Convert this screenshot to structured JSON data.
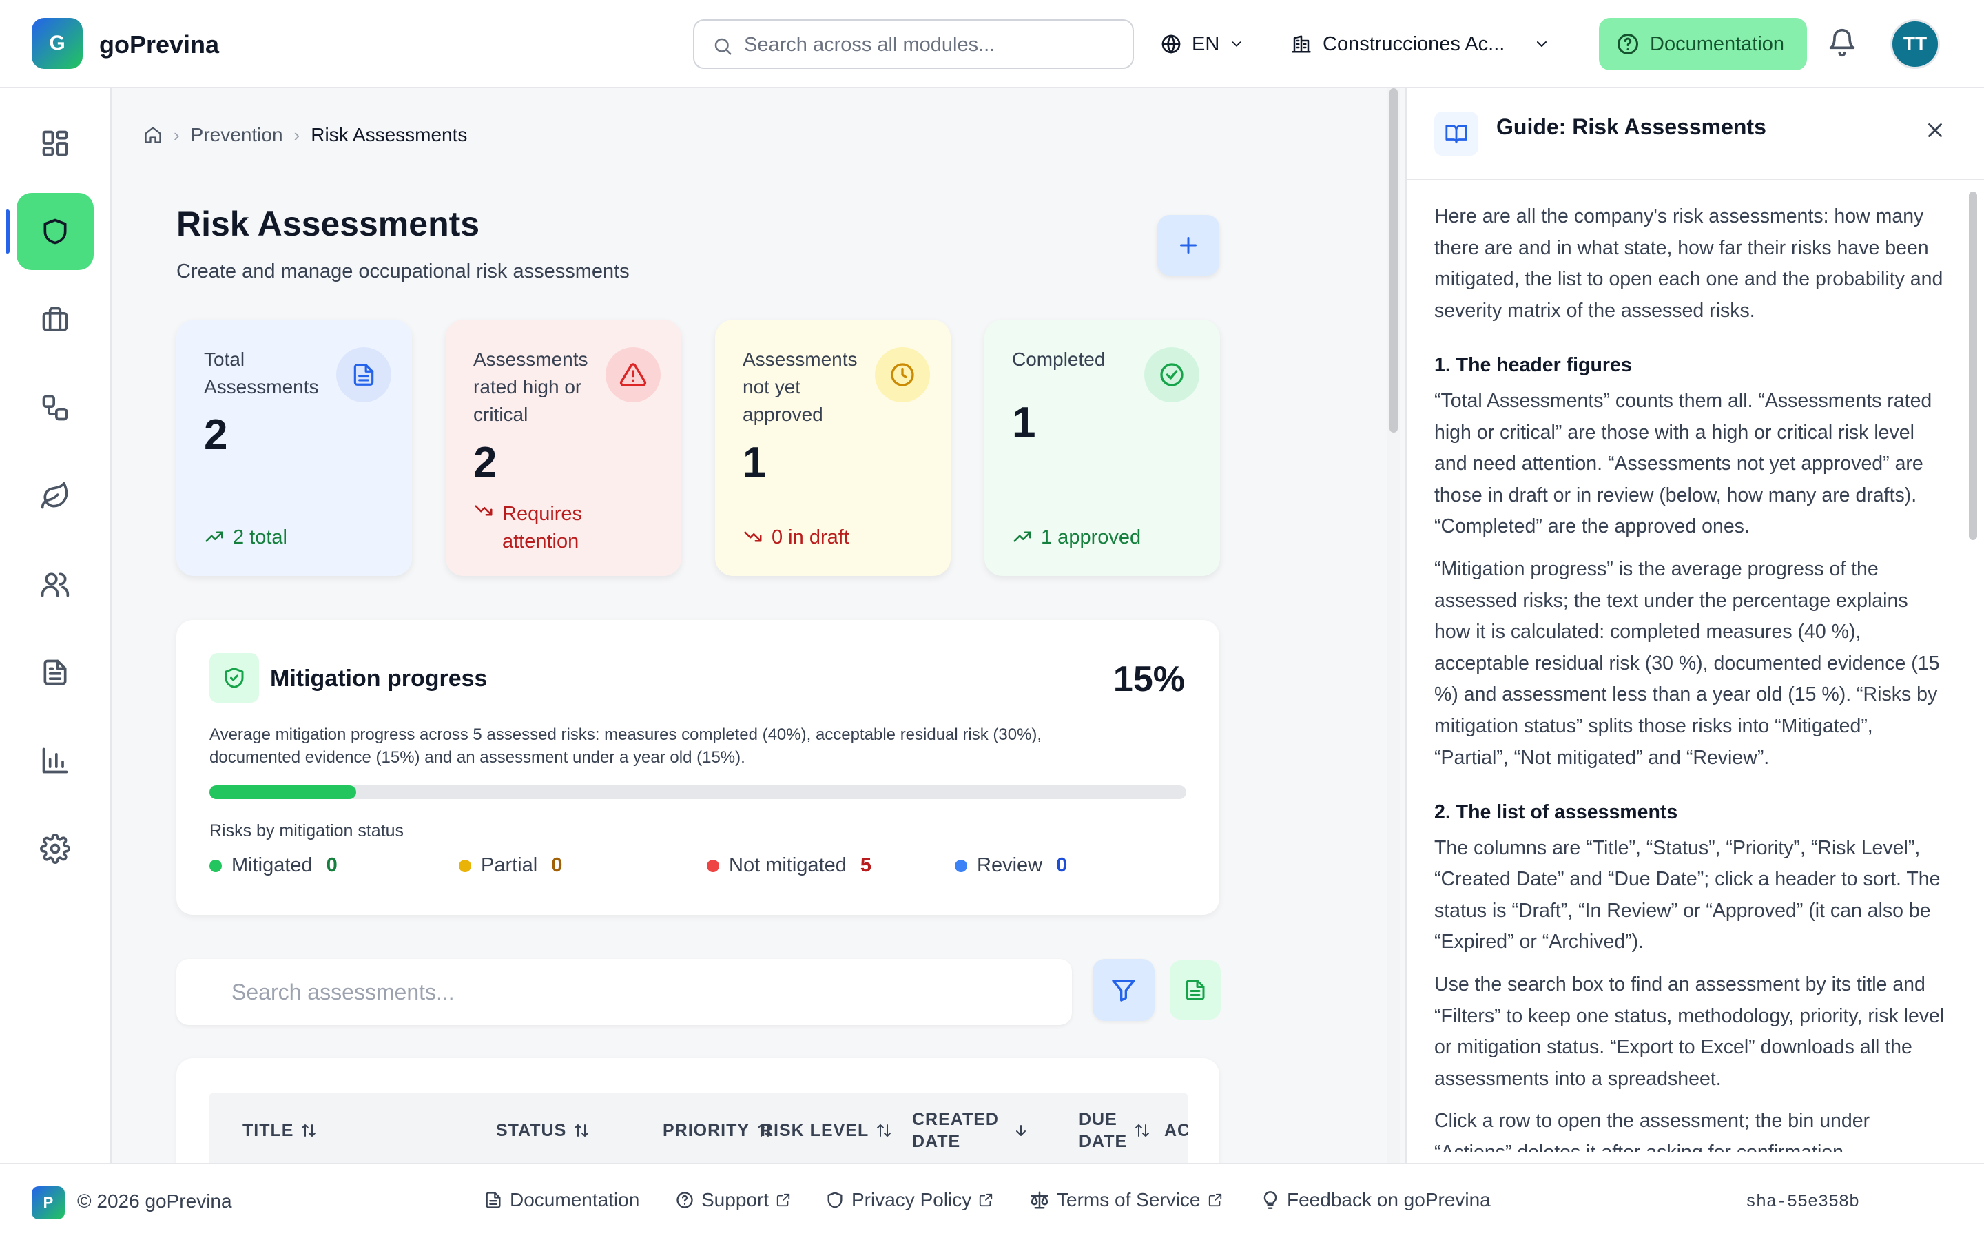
{
  "app": {
    "logo_letter": "G",
    "name": "goPrevina"
  },
  "header": {
    "search_placeholder": "Search across all modules...",
    "language": "EN",
    "company": "Construcciones Ac...",
    "documentation_label": "Documentation",
    "user_initials": "TT"
  },
  "breadcrumb": {
    "section": "Prevention",
    "current": "Risk Assessments"
  },
  "page": {
    "title": "Risk Assessments",
    "subtitle": "Create and manage occupational risk assessments"
  },
  "stats": [
    {
      "label": "Total Assessments",
      "value": "2",
      "trend": "2 total",
      "bg": "#eef4ff",
      "color": "#2563eb"
    },
    {
      "label": "Assessments rated high or critical",
      "value": "2",
      "trend": "Requires attention",
      "bg": "#fdeeee",
      "color": "#dc2626"
    },
    {
      "label": "Assessments not yet approved",
      "value": "1",
      "trend": "0 in draft",
      "bg": "#fefbe6",
      "color": "#ca8a04"
    },
    {
      "label": "Completed",
      "value": "1",
      "trend": "1 approved",
      "bg": "#effbf3",
      "color": "#16a34a"
    }
  ],
  "mitigation": {
    "title": "Mitigation progress",
    "percent_label": "15%",
    "progress": 0.15,
    "description": "Average mitigation progress across 5 assessed risks: measures completed (40%), acceptable residual risk (30%), documented evidence (15%) and an assessment under a year old (15%).",
    "status_label": "Risks by mitigation status",
    "statuses": [
      {
        "label": "Mitigated",
        "count": "0",
        "color": "#22c55e",
        "count_color": "#15803d"
      },
      {
        "label": "Partial",
        "count": "0",
        "color": "#eab308",
        "count_color": "#a16207"
      },
      {
        "label": "Not mitigated",
        "count": "5",
        "color": "#ef4444",
        "count_color": "#b91c1c"
      },
      {
        "label": "Review",
        "count": "0",
        "color": "#3b82f6",
        "count_color": "#1d4ed8"
      }
    ]
  },
  "list": {
    "search_placeholder": "Search assessments...",
    "columns": {
      "title": "TITLE",
      "status": "STATUS",
      "priority": "PRIORITY",
      "risk_level": "RISK LEVEL",
      "created_1": "CREATED",
      "created_2": "DATE",
      "due_1": "DUE",
      "due_2": "DATE",
      "actions": "AC"
    }
  },
  "guide": {
    "title": "Guide: Risk Assessments",
    "intro": "Here are all the company's risk assessments: how many there are and in what state, how far their risks have been mitigated, the list to open each one and the probability and severity matrix of the assessed risks.",
    "h1": "1. The header figures",
    "p1": "“Total Assessments” counts them all. “Assessments rated high or critical” are those with a high or critical risk level and need attention. “Assessments not yet approved” are those in draft or in review (below, how many are drafts). “Completed” are the approved ones.",
    "p2": "“Mitigation progress” is the average progress of the assessed risks; the text under the percentage explains how it is calculated: completed measures (40 %), acceptable residual risk (30 %), documented evidence (15 %) and assessment less than a year old (15 %). “Risks by mitigation status” splits those risks into “Mitigated”, “Partial”, “Not mitigated” and “Review”.",
    "h2": "2. The list of assessments",
    "p3": "The columns are “Title”, “Status”, “Priority”, “Risk Level”, “Created Date” and “Due Date”; click a header to sort. The status is “Draft”, “In Review” or “Approved” (it can also be “Expired” or “Archived”).",
    "p4": "Use the search box to find an assessment by its title and “Filters” to keep one status, methodology, priority, risk level or mitigation status. “Export to Excel” downloads all the assessments into a spreadsheet.",
    "p5": "Click a row to open the assessment; the bin under “Actions” deletes it after asking for confirmation."
  },
  "footer": {
    "logo_letter": "P",
    "copyright": "© 2026 goPrevina",
    "links": {
      "documentation": "Documentation",
      "support": "Support",
      "privacy": "Privacy Policy",
      "terms": "Terms of Service",
      "feedback": "Feedback on goPrevina"
    },
    "version": "sha-55e358b"
  }
}
